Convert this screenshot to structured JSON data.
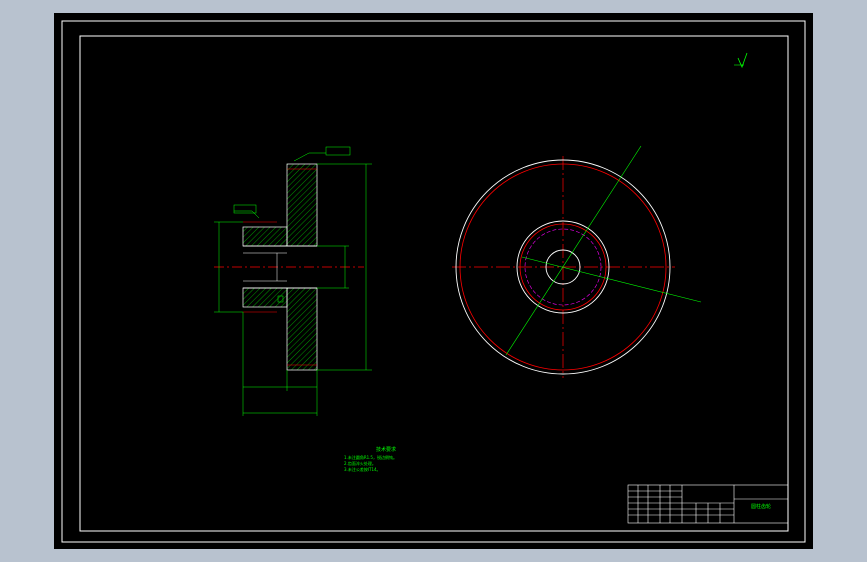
{
  "colors": {
    "background": "#000000",
    "border": "#ffffff",
    "dimension": "#00ff00",
    "centerline": "#ff0000",
    "outline": "#ffffff",
    "hatch": "#00ff00",
    "gear_root": "#ff0000"
  },
  "drawing": {
    "tech_title": "技术要求",
    "tech_notes": [
      "1.未注圆角R1.5，锐边倒钝。",
      "2.齿面淬火处理。",
      "3.未注公差按IT14。"
    ],
    "title_block_name": "圆柱齿轮",
    "roughness_symbol": "√"
  }
}
